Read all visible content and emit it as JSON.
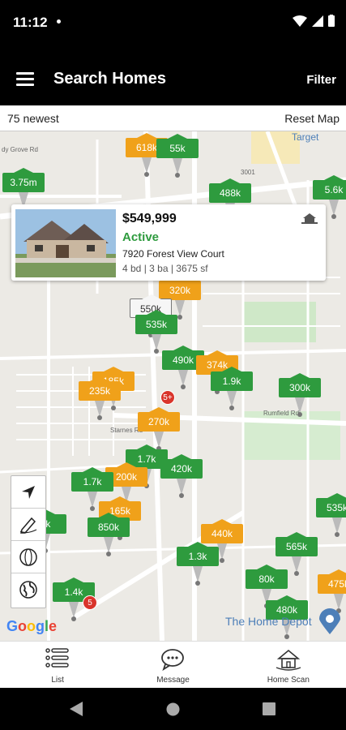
{
  "status_bar": {
    "time": "11:12"
  },
  "app_bar": {
    "title": "Search Homes",
    "filter_label": "Filter"
  },
  "sub_bar": {
    "count_label": "75 newest",
    "reset_label": "Reset Map"
  },
  "listing_card": {
    "price": "$549,999",
    "status": "Active",
    "address": "7920 Forest View Court",
    "specs": "4 bd | 3 ba | 3675 sf"
  },
  "map": {
    "street_labels": [
      "3001",
      "Rumfield Rd",
      "Starnes Rd",
      "Target",
      "dy Grove Rd"
    ],
    "poi_label": "The Home Depot",
    "google_logo": "Google",
    "pins": [
      {
        "label": "618k",
        "color": "orange"
      },
      {
        "label": "55k",
        "color": "green"
      },
      {
        "label": "3.75m",
        "color": "green"
      },
      {
        "label": "488k",
        "color": "green"
      },
      {
        "label": "5.6k",
        "color": "green"
      },
      {
        "label": "320k",
        "color": "orange"
      },
      {
        "label": "550k",
        "color": "white"
      },
      {
        "label": "535k",
        "color": "green"
      },
      {
        "label": "490k",
        "color": "green"
      },
      {
        "label": "374k",
        "color": "orange"
      },
      {
        "label": "1.9k",
        "color": "green"
      },
      {
        "label": "300k",
        "color": "green"
      },
      {
        "label": "185k",
        "color": "orange"
      },
      {
        "label": "235k",
        "color": "orange"
      },
      {
        "label": "270k",
        "color": "orange"
      },
      {
        "label": "1.7k",
        "color": "green"
      },
      {
        "label": "420k",
        "color": "green"
      },
      {
        "label": "200k",
        "color": "orange"
      },
      {
        "label": "1.7k",
        "color": "green"
      },
      {
        "label": "165k",
        "color": "orange"
      },
      {
        "label": "850k",
        "color": "green"
      },
      {
        "label": "440k",
        "color": "orange"
      },
      {
        "label": "1.3k",
        "color": "green"
      },
      {
        "label": "535k",
        "color": "green"
      },
      {
        "label": "565k",
        "color": "green"
      },
      {
        "label": "80k",
        "color": "green"
      },
      {
        "label": "480k",
        "color": "green"
      },
      {
        "label": "475k",
        "color": "orange"
      },
      {
        "label": "1.4k",
        "color": "green"
      },
      {
        "label": "3k",
        "color": "green"
      }
    ],
    "badges": [
      "5+",
      "5"
    ]
  },
  "bottom_nav": {
    "items": [
      {
        "label": "List",
        "icon": "list-icon"
      },
      {
        "label": "Message",
        "icon": "message-icon"
      },
      {
        "label": "Home Scan",
        "icon": "home-scan-icon"
      }
    ]
  },
  "colors": {
    "green": "#2e9b3e",
    "orange": "#f0a11a",
    "badge": "#d9342b"
  }
}
